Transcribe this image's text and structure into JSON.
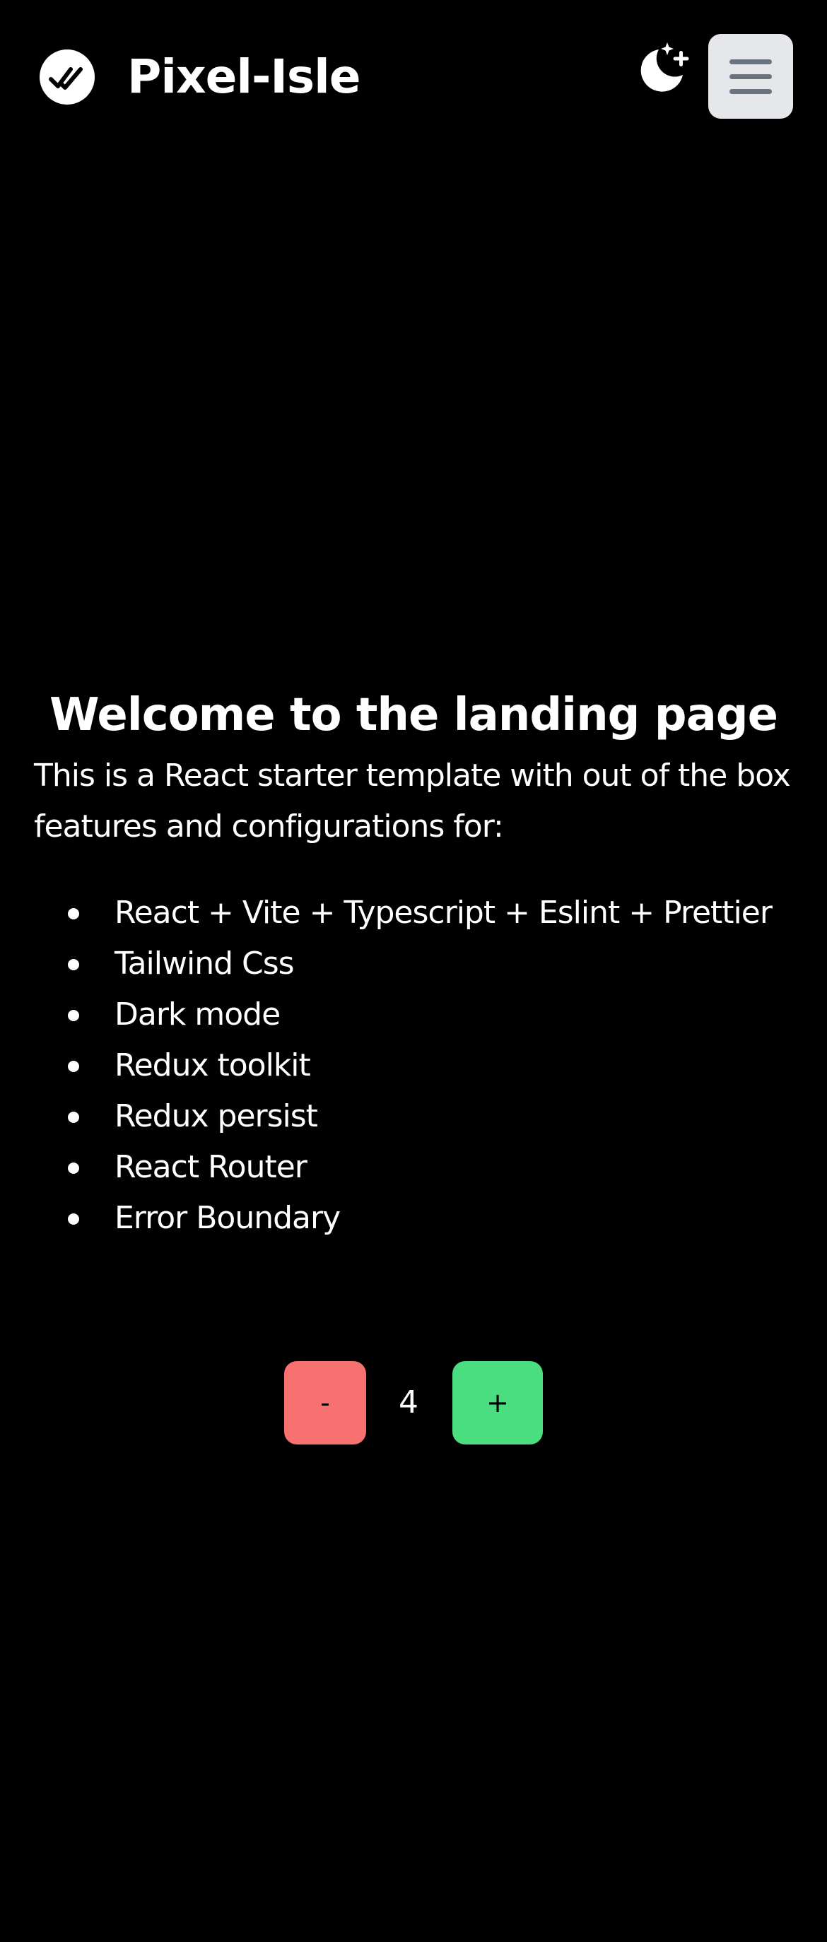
{
  "header": {
    "brand": "Pixel-Isle",
    "logo_icon": "double-check-icon",
    "theme_toggle_icon": "moon-stars-icon",
    "menu_icon": "hamburger-menu-icon"
  },
  "main": {
    "title": "Welcome to the landing page",
    "intro": "This is a React starter template with out of the box features and configurations for:",
    "features": [
      "React + Vite + Typescript + Eslint + Prettier",
      "Tailwind Css",
      "Dark mode",
      "Redux toolkit",
      "Redux persist",
      "React Router",
      "Error Boundary"
    ]
  },
  "counter": {
    "decrement_label": "-",
    "value": "4",
    "increment_label": "+"
  },
  "colors": {
    "background": "#000000",
    "decrement": "#f87171",
    "increment": "#4ade80",
    "menu_button": "#e5e7eb"
  }
}
